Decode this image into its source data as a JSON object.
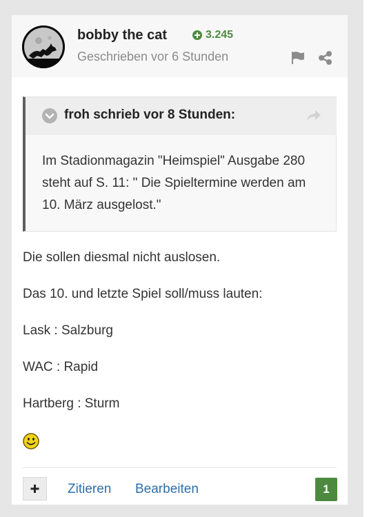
{
  "post": {
    "author": "bobby the cat",
    "reputation": "3.245",
    "meta": "Geschrieben vor 6 Stunden",
    "icons": {
      "reputation": "plus-circle-icon",
      "report": "flag-icon",
      "share": "share-icon",
      "avatar": "cat-moon-avatar"
    }
  },
  "quote": {
    "citation": "froh schrieb vor 8 Stunden:",
    "text": "Im Stadionmagazin \"Heimspiel\" Ausgabe 280 steht auf S. 11: \" Die Spieltermine werden am 10. März ausgelost.\"",
    "icons": {
      "toggle": "chevron-down-icon",
      "goto": "reply-arrow-icon"
    }
  },
  "body": {
    "lines": [
      "Die sollen diesmal nicht auslosen.",
      "Das 10. und letzte Spiel soll/muss lauten:",
      "Lask : Salzburg",
      "WAC : Rapid",
      "Hartberg : Sturm"
    ],
    "emoticon": "smiley-icon"
  },
  "actions": {
    "plus_icon": "plus-icon",
    "quote_label": "Zitieren",
    "edit_label": "Bearbeiten",
    "reaction_count": "1"
  },
  "colors": {
    "accent_green": "#4d8a3f",
    "link_blue": "#2f6ea5",
    "quote_border": "#5f5f5f",
    "page_background": "#e6e6e6"
  }
}
